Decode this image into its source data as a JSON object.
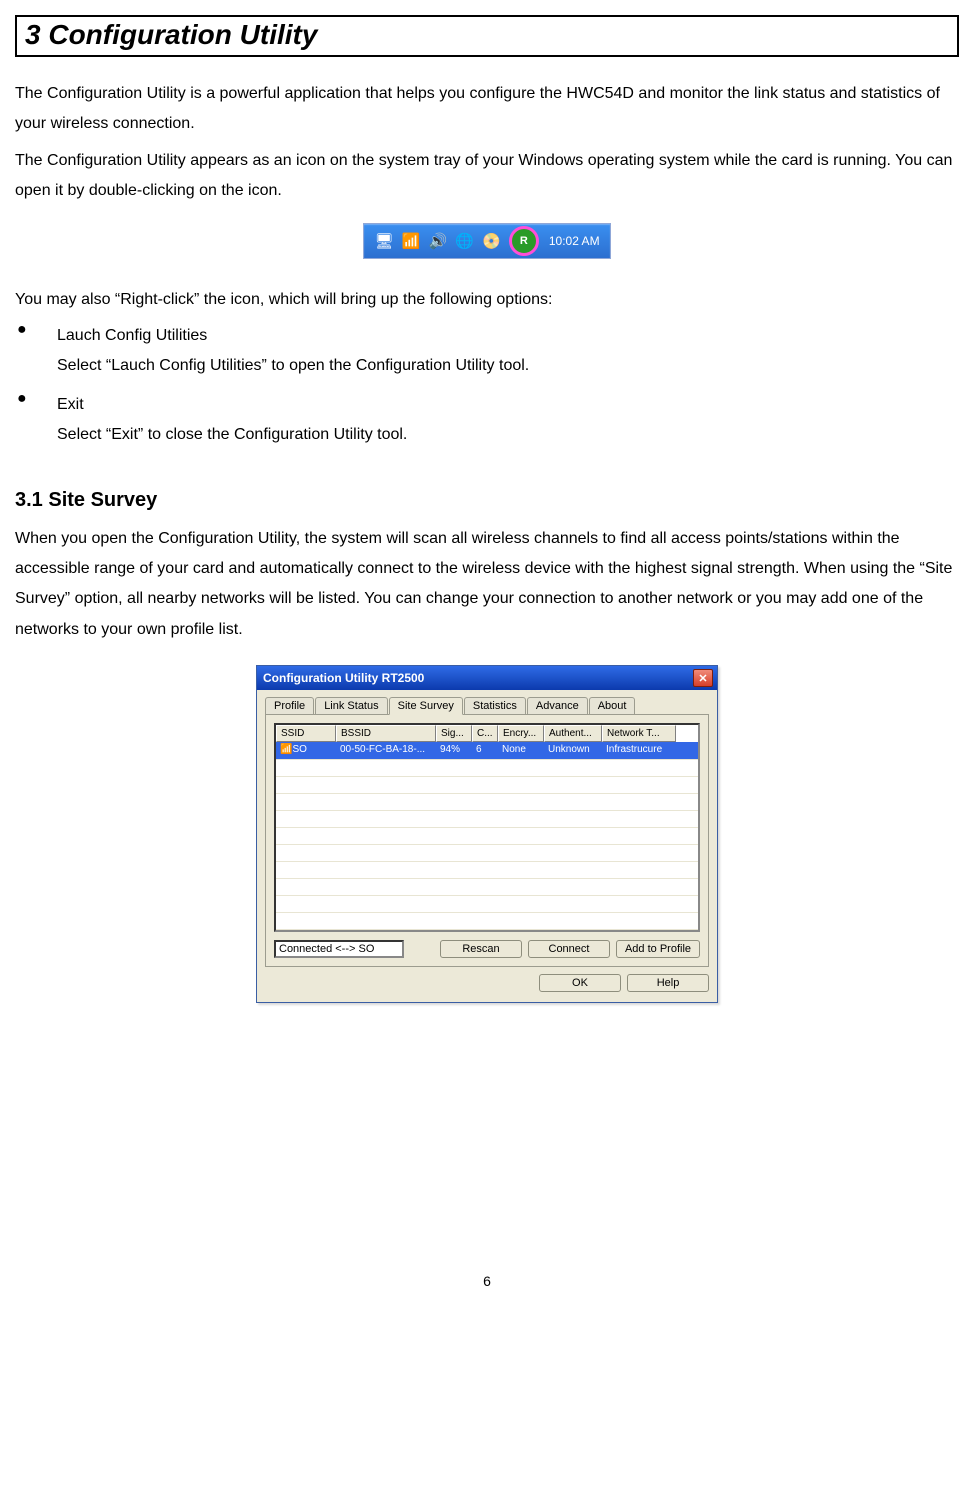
{
  "chapter_title": "3  Configuration Utility",
  "intro_p1": "The Configuration Utility is a powerful application that helps you configure the HWC54D and monitor the link status and statistics of your wireless connection.",
  "intro_p2": "The Configuration Utility appears as an icon on the system tray of your Windows operating system while the card is running. You can open it by double-clicking on the icon.",
  "systray": {
    "circle_label": "R",
    "time": "10:02 AM"
  },
  "after_tray_text": "You may also “Right-click” the icon, which will bring up the following options:",
  "bullets": [
    {
      "title": "Lauch Config Utilities",
      "desc": "Select “Lauch Config Utilities” to open the Configuration Utility tool."
    },
    {
      "title": "Exit",
      "desc": "Select “Exit” to close the Configuration Utility tool."
    }
  ],
  "section_heading": "3.1    Site Survey",
  "section_p": "When you open the Configuration Utility, the system will scan all wireless channels to find all access points/stations within the accessible range of your card and automatically connect to the wireless device with the highest signal strength. When using the “Site Survey” option, all nearby networks will be listed. You can change your connection to another network or you may add one of the networks to your own profile list.",
  "dialog": {
    "title": "Configuration Utility RT2500",
    "tabs": [
      "Profile",
      "Link Status",
      "Site Survey",
      "Statistics",
      "Advance",
      "About"
    ],
    "active_tab": 2,
    "columns": [
      "SSID",
      "BSSID",
      "Sig...",
      "C...",
      "Encry...",
      "Authent...",
      "Network T..."
    ],
    "rows": [
      {
        "ssid": "SO",
        "bssid": "00-50-FC-BA-18-...",
        "sig": "94%",
        "ch": "6",
        "encry": "None",
        "auth": "Unknown",
        "ntype": "Infrastrucure"
      }
    ],
    "status_text": "Connected <--> SO",
    "buttons": {
      "rescan": "Rescan",
      "connect": "Connect",
      "add": "Add to Profile",
      "ok": "OK",
      "help": "Help"
    }
  },
  "page_number": "6"
}
